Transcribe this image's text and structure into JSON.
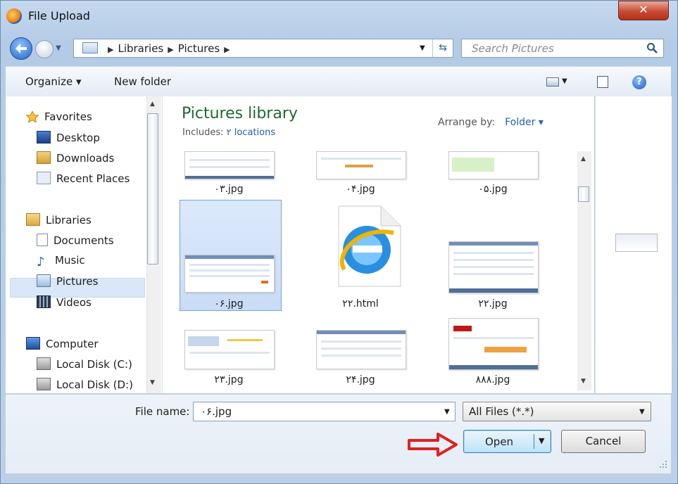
{
  "window": {
    "title": "File Upload",
    "close_glyph": "✕",
    "app_icon": "firefox-icon"
  },
  "address": {
    "crumbs": [
      "Libraries",
      "Pictures"
    ],
    "search_placeholder": "Search Pictures"
  },
  "toolbar": {
    "organize_label": "Organize ▾",
    "new_folder_label": "New folder",
    "help_glyph": "?"
  },
  "nav": {
    "items": [
      {
        "label": "Favorites",
        "icon": "star-icon"
      },
      {
        "label": "Desktop",
        "icon": "desktop-icon"
      },
      {
        "label": "Downloads",
        "icon": "downloads-icon"
      },
      {
        "label": "Recent Places",
        "icon": "recent-places-icon"
      },
      {
        "label": "Libraries",
        "icon": "libraries-icon"
      },
      {
        "label": "Documents",
        "icon": "documents-icon"
      },
      {
        "label": "Music",
        "icon": "music-icon"
      },
      {
        "label": "Pictures",
        "icon": "pictures-icon"
      },
      {
        "label": "Videos",
        "icon": "videos-icon"
      },
      {
        "label": "Computer",
        "icon": "computer-icon"
      },
      {
        "label": "Local Disk (C:)",
        "icon": "disk-icon"
      },
      {
        "label": "Local Disk (D:)",
        "icon": "disk-icon"
      }
    ],
    "selected": "Pictures"
  },
  "library": {
    "title": "Pictures library",
    "includes_label": "Includes:",
    "includes_link": "۲ locations",
    "arrange_label": "Arrange by:",
    "arrange_value": "Folder ▾"
  },
  "files": [
    {
      "name": "۰۳.jpg"
    },
    {
      "name": "۰۴.jpg"
    },
    {
      "name": "۰۵.jpg"
    },
    {
      "name": "۰۶.jpg",
      "selected": true
    },
    {
      "name": "۲۲.html",
      "icon": "internet-explorer-icon"
    },
    {
      "name": "۲۲.jpg"
    },
    {
      "name": "۲۳.jpg"
    },
    {
      "name": "۲۴.jpg"
    },
    {
      "name": "۸۸۸.jpg"
    }
  ],
  "footer": {
    "file_name_label": "File name:",
    "file_name_value": "۰۶.jpg",
    "file_type_value": "All Files (*.*)",
    "open_label": "Open",
    "cancel_label": "Cancel"
  },
  "colors": {
    "annotation_arrow": "#e02020",
    "library_title": "#1e6a2e",
    "link": "#1f5fb8"
  }
}
